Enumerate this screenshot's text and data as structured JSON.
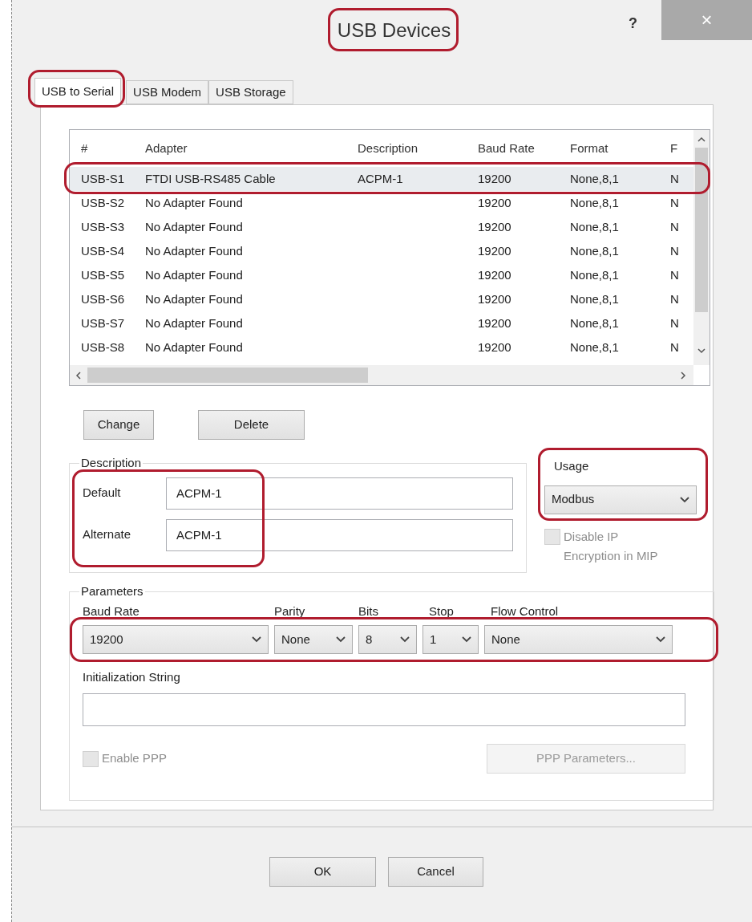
{
  "window": {
    "title": "USB Devices",
    "title_highlighted": true,
    "help": "?",
    "close": "×"
  },
  "tabs": [
    {
      "label": "USB to Serial",
      "selected": true,
      "highlighted": true
    },
    {
      "label": "USB Modem",
      "selected": false,
      "highlighted": false
    },
    {
      "label": "USB Storage",
      "selected": false,
      "highlighted": false
    }
  ],
  "adapters": {
    "columns": [
      "#",
      "Adapter",
      "Description",
      "Baud Rate",
      "Format",
      "F"
    ],
    "rows": [
      {
        "cells": [
          "USB-S1",
          "FTDI USB-RS485 Cable",
          "ACPM-1",
          "19200",
          "None,8,1",
          "N"
        ],
        "selected": true,
        "highlighted": true
      },
      {
        "cells": [
          "USB-S2",
          "No Adapter Found",
          "",
          "19200",
          "None,8,1",
          "N"
        ],
        "selected": false,
        "highlighted": false
      },
      {
        "cells": [
          "USB-S3",
          "No Adapter Found",
          "",
          "19200",
          "None,8,1",
          "N"
        ],
        "selected": false,
        "highlighted": false
      },
      {
        "cells": [
          "USB-S4",
          "No Adapter Found",
          "",
          "19200",
          "None,8,1",
          "N"
        ],
        "selected": false,
        "highlighted": false
      },
      {
        "cells": [
          "USB-S5",
          "No Adapter Found",
          "",
          "19200",
          "None,8,1",
          "N"
        ],
        "selected": false,
        "highlighted": false
      },
      {
        "cells": [
          "USB-S6",
          "No Adapter Found",
          "",
          "19200",
          "None,8,1",
          "N"
        ],
        "selected": false,
        "highlighted": false
      },
      {
        "cells": [
          "USB-S7",
          "No Adapter Found",
          "",
          "19200",
          "None,8,1",
          "N"
        ],
        "selected": false,
        "highlighted": false
      },
      {
        "cells": [
          "USB-S8",
          "No Adapter Found",
          "",
          "19200",
          "None,8,1",
          "N"
        ],
        "selected": false,
        "highlighted": false
      }
    ]
  },
  "buttons": [
    "Change",
    "Delete"
  ],
  "description": {
    "label": "Description",
    "highlighted": true,
    "fields": [
      {
        "label": "Default",
        "value": "ACPM-1"
      },
      {
        "label": "Alternate",
        "value": "ACPM-1"
      }
    ]
  },
  "usage": {
    "label": "Usage",
    "value": "Modbus",
    "highlighted": true
  },
  "disable_ip_encryption": {
    "label": "Disable IP Encryption in MIP",
    "checked": false,
    "disabled": true
  },
  "parameters": {
    "label": "Parameters",
    "highlighted": true,
    "dropdowns": [
      {
        "label": "Baud Rate",
        "value": "19200"
      },
      {
        "label": "Parity",
        "value": "None"
      },
      {
        "label": "Bits",
        "value": "8"
      },
      {
        "label": "Stop",
        "value": "1"
      },
      {
        "label": "Flow Control",
        "value": "None"
      }
    ],
    "init_string": {
      "label": "Initialization String"
    },
    "enable_ppp": {
      "label": "Enable PPP",
      "checked": false,
      "disabled": true
    },
    "ppp_button": {
      "label": "PPP Parameters...",
      "disabled": true
    }
  },
  "dialog_buttons": [
    "OK",
    "Cancel"
  ]
}
